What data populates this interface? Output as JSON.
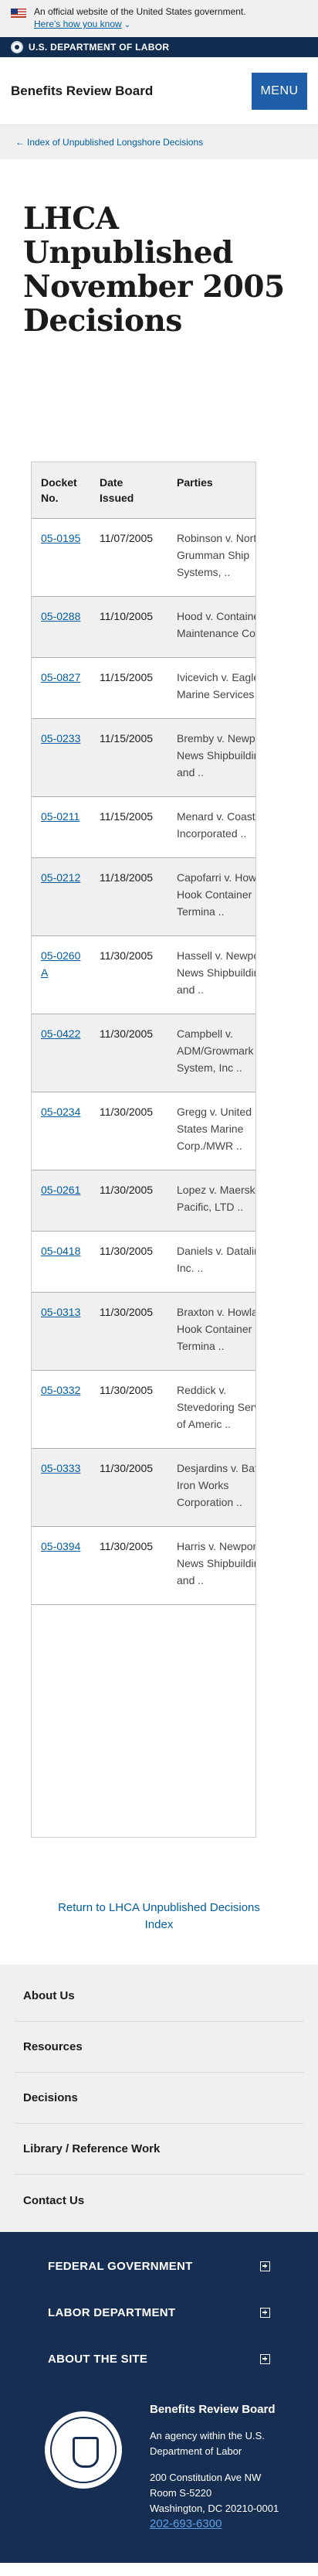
{
  "gov_banner": {
    "text": "An official website of the United States government.",
    "link": "Here's how you know"
  },
  "dol_bar": {
    "label": "U.S. DEPARTMENT OF LABOR"
  },
  "header": {
    "title": "Benefits Review Board",
    "menu_label": "MENU"
  },
  "breadcrumb": {
    "label": "Index of Unpublished Longshore Decisions"
  },
  "page": {
    "title": "LHCA Unpublished November 2005 Decisions"
  },
  "table": {
    "headers": [
      "Docket No.",
      "Date Issued",
      "Parties"
    ],
    "rows": [
      {
        "docket": "05-0195",
        "date": "11/07/2005",
        "parties": "Robinson v. Northrop Grumman Ship Systems, .."
      },
      {
        "docket": "05-0288",
        "date": "11/10/2005",
        "parties": "Hood v. Container Maintenance Corp. .."
      },
      {
        "docket": "05-0827",
        "date": "11/15/2005",
        "parties": "Ivicevich v. Eagle Marine Services .."
      },
      {
        "docket": "05-0233",
        "date": "11/15/2005",
        "parties": "Bremby v. Newport News Shipbuilding and .."
      },
      {
        "docket": "05-0211",
        "date": "11/15/2005",
        "parties": "Menard v. Coastline, Incorporated .."
      },
      {
        "docket": "05-0212",
        "date": "11/18/2005",
        "parties": "Capofarri v. Howland Hook Container Termina .."
      },
      {
        "docket": "05-0260A",
        "date": "11/30/2005",
        "parties": "Hassell v. Newport News Shipbuilding and .."
      },
      {
        "docket": "05-0422",
        "date": "11/30/2005",
        "parties": "Campbell v. ADM/Growmark River System, Inc .."
      },
      {
        "docket": "05-0234",
        "date": "11/30/2005",
        "parties": "Gregg v. United States Marine Corp./MWR .."
      },
      {
        "docket": "05-0261",
        "date": "11/30/2005",
        "parties": "Lopez v. Maersk Pacific, LTD .."
      },
      {
        "docket": "05-0418",
        "date": "11/30/2005",
        "parties": "Daniels v. Dataline, Inc. .."
      },
      {
        "docket": "05-0313",
        "date": "11/30/2005",
        "parties": "Braxton v. Howland Hook Container Termina .."
      },
      {
        "docket": "05-0332",
        "date": "11/30/2005",
        "parties": "Reddick v. Stevedoring Services of Americ .."
      },
      {
        "docket": "05-0333",
        "date": "11/30/2005",
        "parties": "Desjardins v. Bath Iron Works Corporation .."
      },
      {
        "docket": "05-0394",
        "date": "11/30/2005",
        "parties": "Harris v. Newport News Shipbuilding and .."
      }
    ]
  },
  "return_link": {
    "label": "Return to LHCA Unpublished Decisions Index"
  },
  "footer_nav": {
    "items": [
      "About Us",
      "Resources",
      "Decisions",
      "Library / Reference Work",
      "Contact Us"
    ]
  },
  "footer": {
    "accordions": [
      "FEDERAL GOVERNMENT",
      "LABOR DEPARTMENT",
      "ABOUT THE SITE"
    ],
    "org_name": "Benefits Review Board",
    "agency_line": "An agency within the U.S. Department of Labor",
    "address_line1": "200 Constitution Ave NW",
    "address_line2": "Room S-5220",
    "address_line3": "Washington, DC 20210-0001",
    "phone": "202-693-6300"
  },
  "colors": {
    "link": "#005ea2",
    "header_dark": "#112e51",
    "menu_button": "#1f5ea8",
    "footer_dark": "#162e51",
    "light_gray": "#f0f0f0"
  }
}
